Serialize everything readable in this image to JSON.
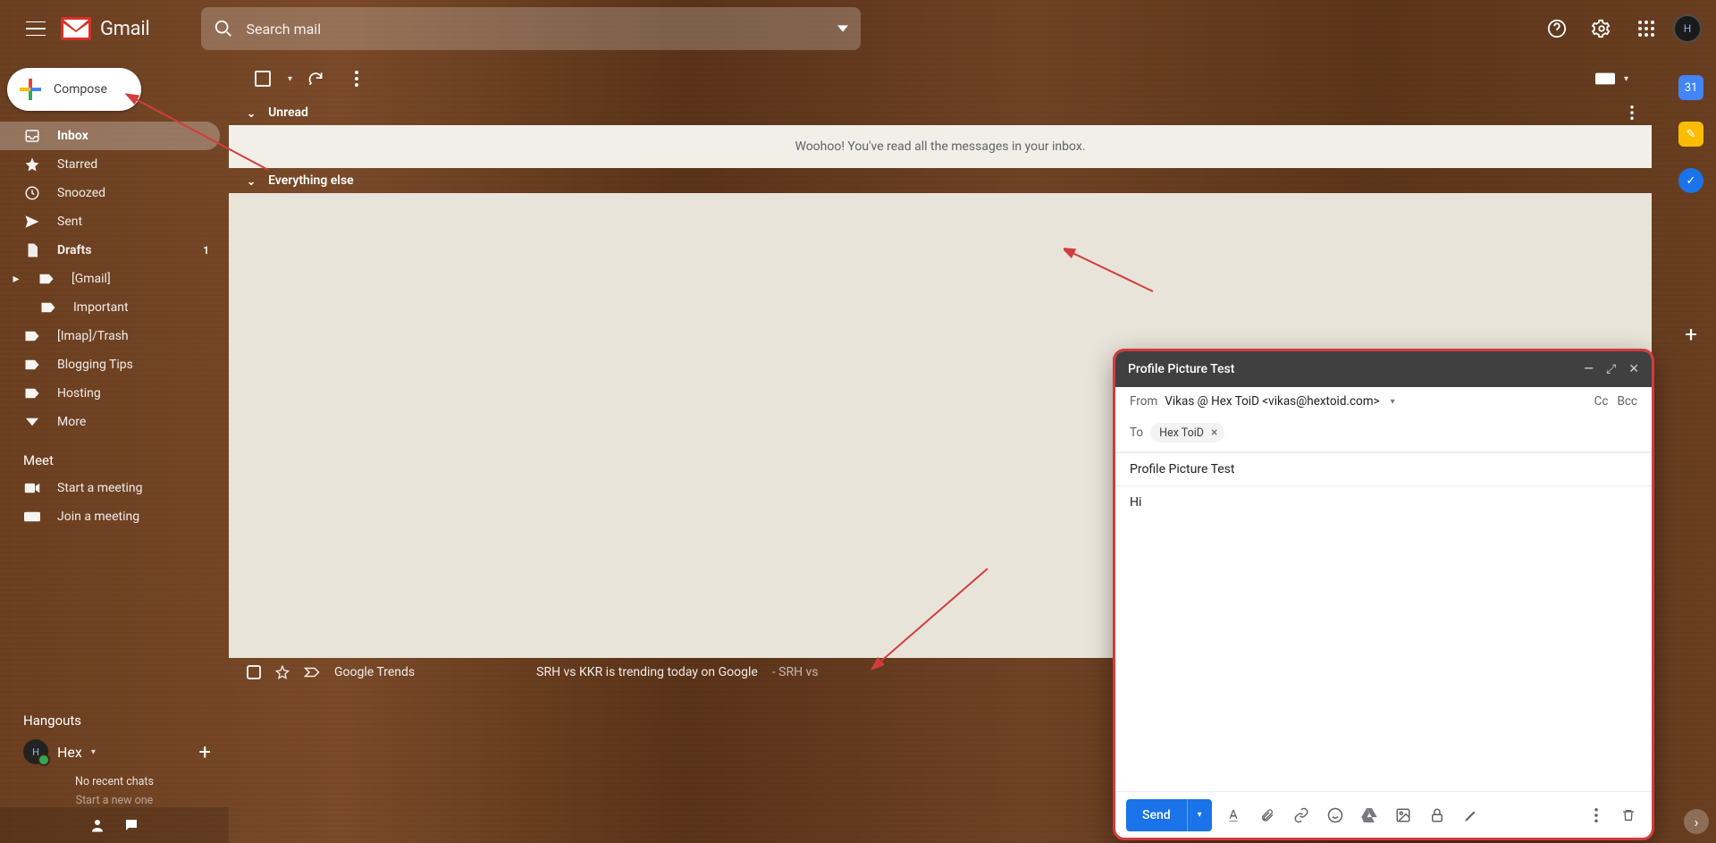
{
  "header": {
    "product": "Gmail",
    "search_placeholder": "Search mail",
    "avatar_initial": "H"
  },
  "sidebar": {
    "compose": "Compose",
    "items": [
      {
        "icon": "inbox-icon",
        "label": "Inbox",
        "active": true,
        "bold": true
      },
      {
        "icon": "star-icon",
        "label": "Starred"
      },
      {
        "icon": "clock-icon",
        "label": "Snoozed"
      },
      {
        "icon": "send-icon",
        "label": "Sent"
      },
      {
        "icon": "draft-icon",
        "label": "Drafts",
        "bold": true,
        "count": "1"
      },
      {
        "icon": "label-icon",
        "label": "[Gmail]",
        "expandable": true
      },
      {
        "icon": "label-icon",
        "label": "Important",
        "sub": true
      },
      {
        "icon": "label-icon",
        "label": "[Imap]/Trash"
      },
      {
        "icon": "label-icon",
        "label": "Blogging Tips"
      },
      {
        "icon": "label-icon",
        "label": "Hosting"
      },
      {
        "icon": "chevron-down-icon",
        "label": "More"
      }
    ],
    "meet": {
      "heading": "Meet",
      "start": "Start a meeting",
      "join": "Join a meeting"
    },
    "hangouts": {
      "heading": "Hangouts",
      "user": "Hex",
      "no_recent": "No recent chats",
      "start_new": "Start a new one"
    }
  },
  "main": {
    "sections": {
      "unread": "Unread",
      "everything": "Everything else"
    },
    "empty": "Woohoo! You've read all the messages in your inbox.",
    "bottom": {
      "source": "Google Trends",
      "text": "SRH vs KKR is trending today on Google",
      "suffix": " - SRH vs"
    }
  },
  "compose_window": {
    "title": "Profile Picture Test",
    "from_label": "From",
    "from_value": "Vikas @ Hex ToiD <vikas@hextoid.com>",
    "to_label": "To",
    "to_chip": "Hex ToiD",
    "cc": "Cc",
    "bcc": "Bcc",
    "subject": "Profile Picture Test",
    "body": "Hi",
    "send": "Send"
  },
  "rightrail": {
    "calendar_day": "31"
  },
  "colors": {
    "accent": "#1a73e8",
    "annotation": "#d23c3c"
  }
}
